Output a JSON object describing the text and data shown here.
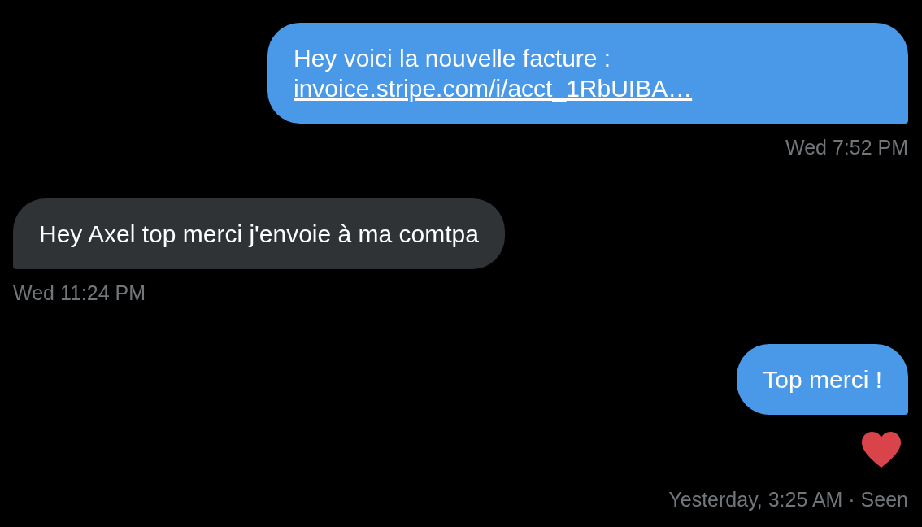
{
  "messages": [
    {
      "kind": "sent",
      "text": "Hey voici la nouvelle facture :",
      "link": "invoice.stripe.com/i/acct_1RbUIBA…",
      "timestamp": "Wed 7:52 PM"
    },
    {
      "kind": "received",
      "text": "Hey Axel top merci j'envoie à ma comtpa",
      "timestamp": "Wed 11:24 PM"
    },
    {
      "kind": "sent",
      "text": "Top merci !",
      "timestamp": "Yesterday, 3:25 AM · Seen",
      "liked": true
    }
  ]
}
